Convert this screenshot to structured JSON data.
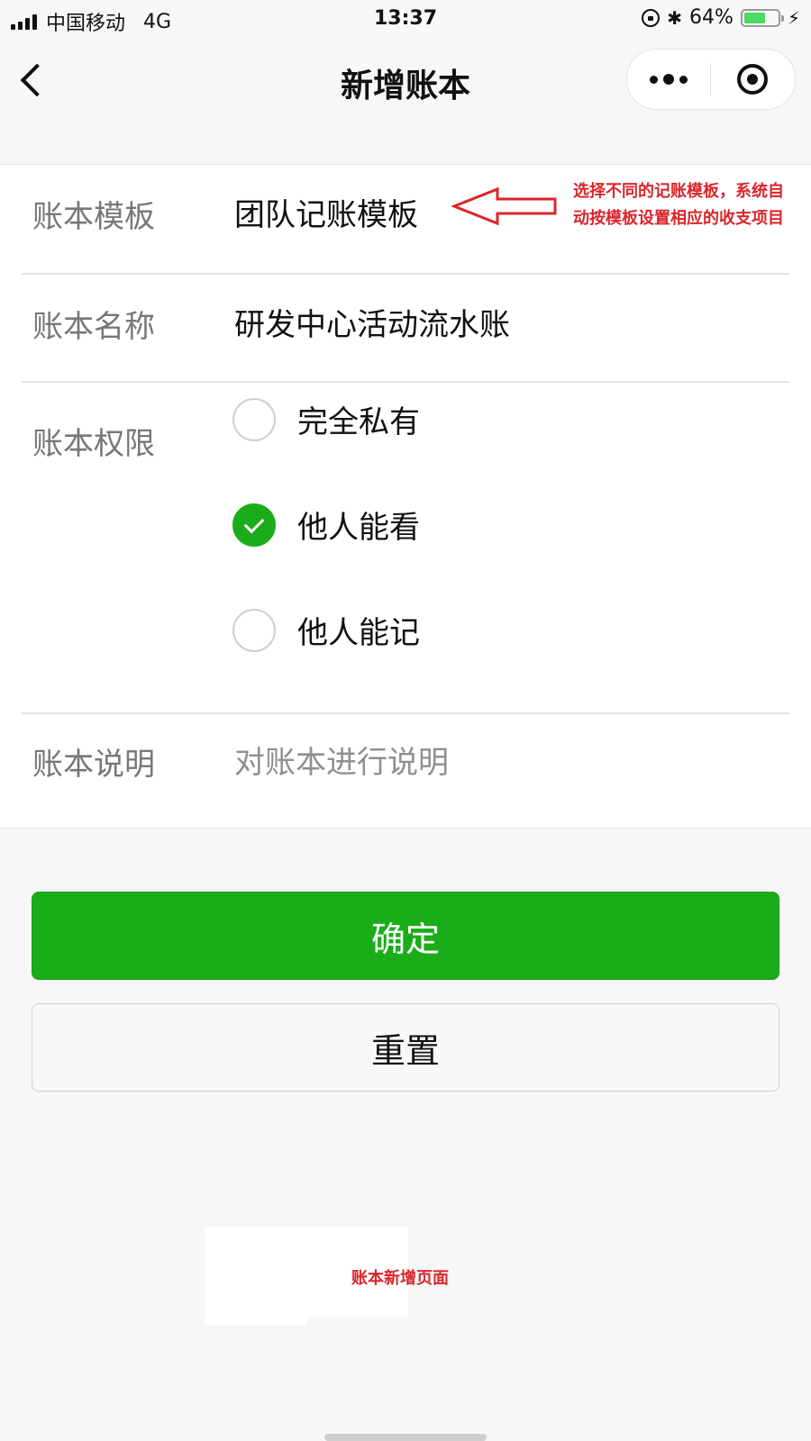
{
  "status_bar": {
    "carrier": "中国移动",
    "network": "4G",
    "time": "13:37",
    "battery": "64%",
    "battery_level": 0.64,
    "battery_color": "#4cd964"
  },
  "nav": {
    "back_icon": "chevron-left",
    "title": "新增账本",
    "more_icon": "more-dots",
    "close_icon": "target-circle"
  },
  "form": {
    "template": {
      "label": "账本模板",
      "value": "团队记账模板"
    },
    "name": {
      "label": "账本名称",
      "value": "研发中心活动流水账"
    },
    "permission": {
      "label": "账本权限",
      "options": [
        {
          "label": "完全私有",
          "checked": false
        },
        {
          "label": "他人能看",
          "checked": true
        },
        {
          "label": "他人能记",
          "checked": false
        }
      ]
    },
    "description": {
      "label": "账本说明",
      "placeholder": "对账本进行说明"
    }
  },
  "annotation": {
    "text": "选择不同的记账模板，系统自动按模板设置相应的收支项目",
    "color": "#d9262c"
  },
  "buttons": {
    "confirm": "确定",
    "reset": "重置",
    "primary_color": "#1aad19"
  },
  "caption": "账本新增页面"
}
